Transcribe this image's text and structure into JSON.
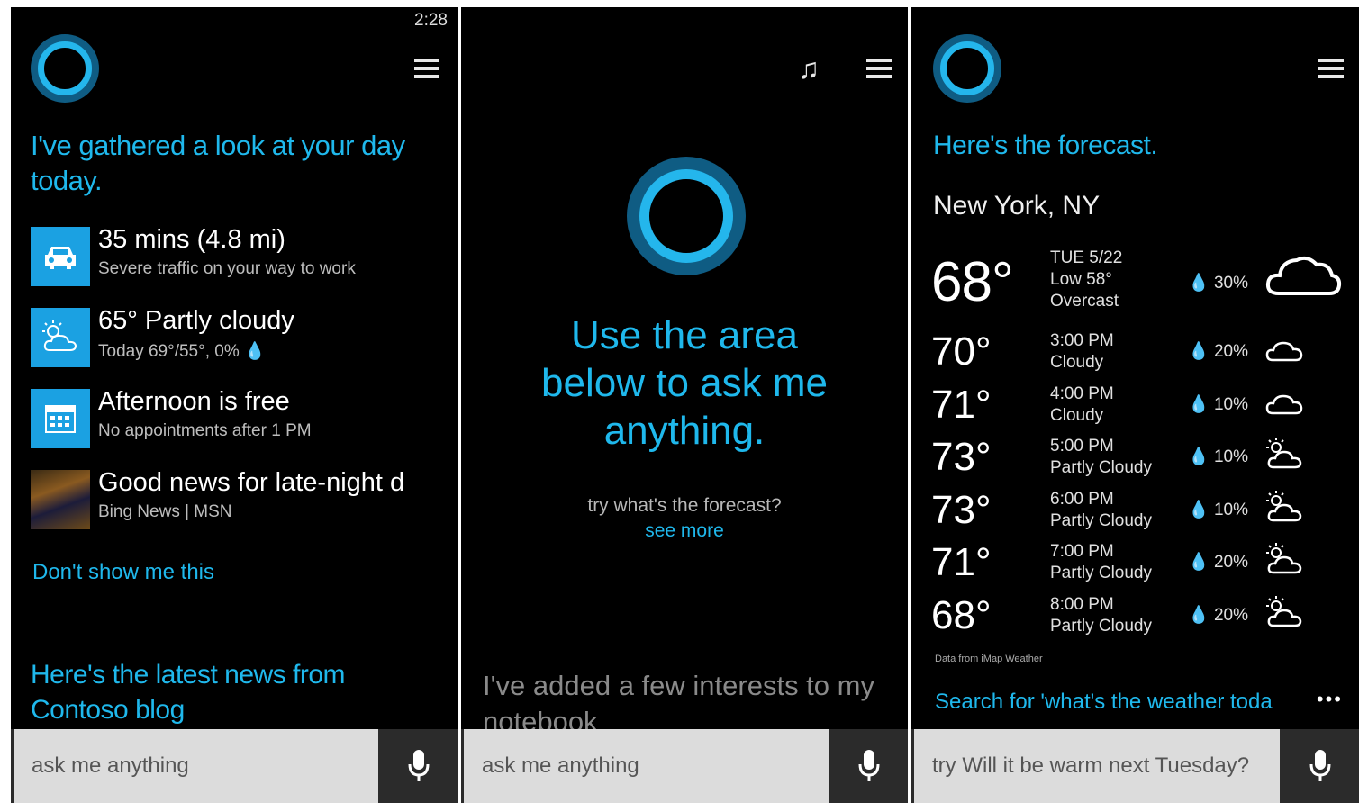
{
  "screen1": {
    "status_time": "2:28",
    "greeting": "I've gathered a look at your day today.",
    "cards": [
      {
        "icon": "car-icon",
        "title": "35 mins (4.8 mi)",
        "subtitle": "Severe traffic on your way to work"
      },
      {
        "icon": "partly-cloudy-icon",
        "title": "65° Partly cloudy",
        "subtitle": "Today 69°/55°, 0% 💧"
      },
      {
        "icon": "calendar-icon",
        "title": "Afternoon is free",
        "subtitle": "No appointments after 1 PM"
      },
      {
        "icon": "news-thumbnail",
        "title": "Good news for late-night d",
        "subtitle": "Bing News | MSN"
      }
    ],
    "dismiss_link": "Don't show me this",
    "news_header": "Here's the latest news from Contoso blog",
    "search_placeholder": "ask me anything"
  },
  "screen2": {
    "prompt": "Use the area below to ask me anything.",
    "suggestion": "try what's the forecast?",
    "see_more": "see more",
    "notebook_text": "I've added a few interests to my notebook",
    "search_placeholder": "ask me anything"
  },
  "screen3": {
    "header": "Here's the forecast.",
    "city": "New York, NY",
    "current": {
      "temp": "68°",
      "date": "TUE 5/22",
      "low": "Low 58°",
      "condition": "Overcast",
      "precip": "30%"
    },
    "hourly": [
      {
        "temp": "70°",
        "time": "3:00 PM",
        "condition": "Cloudy",
        "precip": "20%"
      },
      {
        "temp": "71°",
        "time": "4:00 PM",
        "condition": "Cloudy",
        "precip": "10%"
      },
      {
        "temp": "73°",
        "time": "5:00 PM",
        "condition": "Partly Cloudy",
        "precip": "10%"
      },
      {
        "temp": "73°",
        "time": "6:00 PM",
        "condition": "Partly Cloudy",
        "precip": "10%"
      },
      {
        "temp": "71°",
        "time": "7:00 PM",
        "condition": "Partly Cloudy",
        "precip": "20%"
      },
      {
        "temp": "68°",
        "time": "8:00 PM",
        "condition": "Partly Cloudy",
        "precip": "20%"
      }
    ],
    "attribution": "Data from iMap Weather",
    "search_link": "Search for 'what's the weather toda",
    "more": "•••",
    "search_placeholder": "try Will it be warm next Tuesday?"
  },
  "colors": {
    "accent": "#1fb8ec",
    "tile": "#1ba1e2",
    "ring_outer": "#0f5c83",
    "background": "#000000"
  }
}
